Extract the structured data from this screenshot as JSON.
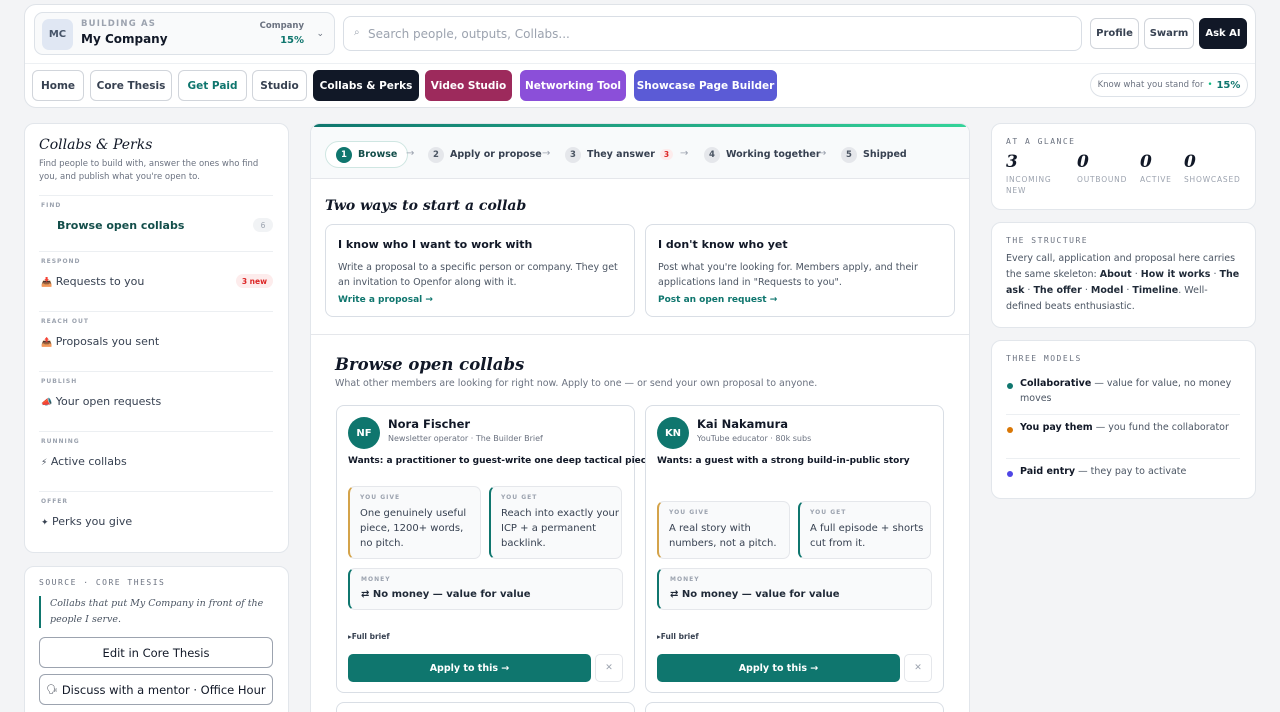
{
  "header": {
    "building_as_label": "BUILDING AS",
    "company_initials": "MC",
    "company_name": "My Company",
    "company_label": "Company",
    "company_percent": "15%",
    "search_placeholder": "Search people, outputs, Collabs...",
    "buttons": {
      "profile": "Profile",
      "swarm": "Swarm",
      "ask_ai": "Ask AI"
    }
  },
  "nav": {
    "items": [
      "Home",
      "Core Thesis",
      "Get Paid",
      "Studio",
      "Collabs & Perks",
      "Video Studio",
      "Networking Tool",
      "Showcase Page Builder"
    ],
    "know_label": "Know what you stand for",
    "know_percent": "15%"
  },
  "colors": {
    "accent": "#0f766e",
    "video_studio": "#9d2a5c",
    "networking": "#8b4fd9",
    "showcase": "#5b5bd6"
  },
  "left": {
    "title": "Collabs & Perks",
    "subtitle": "Find people to build with, answer the ones who find you, and publish what you're open to.",
    "sections": [
      {
        "kicker": "FIND",
        "label": "Browse open collabs",
        "count": "6",
        "icon": ""
      },
      {
        "kicker": "RESPOND",
        "label": "Requests to you",
        "count": "3 new",
        "icon": "📥"
      },
      {
        "kicker": "REACH OUT",
        "label": "Proposals you sent",
        "icon": "📤"
      },
      {
        "kicker": "PUBLISH",
        "label": "Your open requests",
        "icon": "📣"
      },
      {
        "kicker": "RUNNING",
        "label": "Active collabs",
        "icon": "⚡"
      },
      {
        "kicker": "OFFER",
        "label": "Perks you give",
        "icon": "✦"
      }
    ],
    "source_label": "SOURCE · CORE THESIS",
    "quote": "Collabs that put My Company in front of the people I serve.",
    "edit_button": "Edit in Core Thesis",
    "mentor_button": "Discuss with a mentor · Office Hour",
    "mentor_icon": "🗣"
  },
  "steps": [
    {
      "n": "1",
      "label": "Browse"
    },
    {
      "n": "2",
      "label": "Apply or propose"
    },
    {
      "n": "3",
      "label": "They answer",
      "badge": "3"
    },
    {
      "n": "4",
      "label": "Working together"
    },
    {
      "n": "5",
      "label": "Shipped"
    }
  ],
  "main": {
    "two_ways_title": "Two ways to start a collab",
    "options": [
      {
        "title": "I know who I want to work with",
        "desc": "Write a proposal to a specific person or company. They get an invitation to Openfor along with it.",
        "link": "Write a proposal →"
      },
      {
        "title": "I don't know who yet",
        "desc": "Post what you're looking for. Members apply, and their applications land in \"Requests to you\".",
        "link": "Post an open request →"
      }
    ],
    "browse_title": "Browse open collabs",
    "browse_sub": "What other members are looking for right now. Apply to one — or send your own proposal to anyone.",
    "cards": [
      {
        "initials": "NF",
        "name": "Nora Fischer",
        "role": "Newsletter operator · The Builder Brief",
        "wants": "Wants: a practitioner to guest-write one deep tactical piece",
        "give_label": "YOU GIVE",
        "give": "One genuinely useful piece, 1200+ words, no pitch.",
        "get_label": "YOU GET",
        "get": "Reach into exactly your ICP + a permanent backlink.",
        "money_label": "MONEY",
        "money": "⇄ No money — value for value",
        "full_brief": "▸Full brief",
        "apply": "Apply to this →",
        "dismiss": "✕"
      },
      {
        "initials": "KN",
        "name": "Kai Nakamura",
        "role": "YouTube educator · 80k subs",
        "wants": "Wants: a guest with a strong build-in-public story",
        "give_label": "YOU GIVE",
        "give": "A real story with numbers, not a pitch.",
        "get_label": "YOU GET",
        "get": "A full episode + shorts cut from it.",
        "money_label": "MONEY",
        "money": "⇄ No money — value for value",
        "full_brief": "▸Full brief",
        "apply": "Apply to this →",
        "dismiss": "✕"
      }
    ]
  },
  "right": {
    "glance_label": "AT A GLANCE",
    "glance": [
      {
        "value": "3",
        "label": "INCOMING NEW"
      },
      {
        "value": "0",
        "label": "OUTBOUND"
      },
      {
        "value": "0",
        "label": "ACTIVE"
      },
      {
        "value": "0",
        "label": "SHOWCASED"
      }
    ],
    "structure_label": "THE STRUCTURE",
    "structure_text": "Every call, application and proposal here carries the same skeleton:",
    "structure_parts": [
      "About",
      "How it works",
      "The ask",
      "The offer",
      "Model",
      "Timeline"
    ],
    "structure_end": "Well-defined beats enthusiastic.",
    "models_label": "THREE MODELS",
    "models": [
      {
        "name": "Collaborative",
        "desc": "— value for value, no money moves",
        "color": "#0f766e"
      },
      {
        "name": "You pay them",
        "desc": "— you fund the collaborator",
        "color": "#d97706"
      },
      {
        "name": "Paid entry",
        "desc": "— they pay to activate",
        "color": "#4f46e5"
      }
    ]
  }
}
